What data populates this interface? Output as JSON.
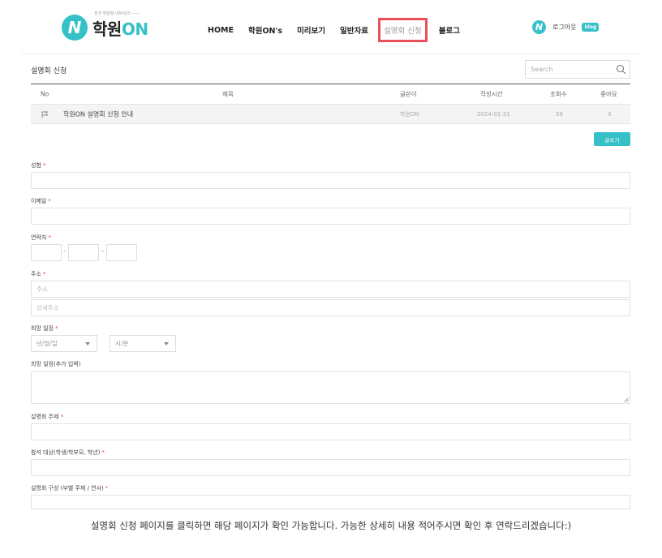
{
  "header": {
    "logo_badge": "N",
    "logo_tagline": "전국 학원장 네트워크 ——",
    "logo_name": "학원",
    "logo_name_on": "ON",
    "nav": [
      "HOME",
      "학원ON's",
      "미리보기",
      "일반자료",
      "설명회 신청",
      "블로그"
    ],
    "active_nav": "설명회 신청",
    "user_badge": "N",
    "logout": "로그아웃",
    "blog_badge": "blog"
  },
  "board": {
    "title": "설명회 신청",
    "search_placeholder": "Search",
    "columns": [
      "No",
      "제목",
      "글쓴이",
      "작성시간",
      "조회수",
      "좋아요"
    ],
    "rows": [
      {
        "title": "학원ON 설명회 신청 안내",
        "author": "학원ON",
        "date": "2024-01-31",
        "views": "59",
        "likes": "0"
      }
    ],
    "write_button": "글쓰기"
  },
  "form": {
    "name_label": "성함",
    "email_label": "이메일",
    "phone_label": "연락처",
    "phone_sep": "-",
    "address_label": "주소",
    "address_placeholder": "주소",
    "address_detail_placeholder": "상세주소",
    "date_label": "희망 일정",
    "date_select": "년/월/일",
    "time_select": "시/분",
    "date_extra_label": "희망 일정(추가 입력)",
    "topic_label": "설명회 주제",
    "audience_label": "참석 대상(학생/학부모, 학년)",
    "structure_label": "설명회 구성 (부별 주제 / 연사)",
    "required_mark": "*"
  },
  "caption": "설명회 신청 페이지를 클릭하면 해당 페이지가 확인 가능합니다. 가능한 상세히 내용 적어주시면 확인 후 연락드리겠습니다:)",
  "colors": {
    "accent": "#36c0c7",
    "highlight": "#ea4f5c",
    "required": "#e4464e"
  }
}
